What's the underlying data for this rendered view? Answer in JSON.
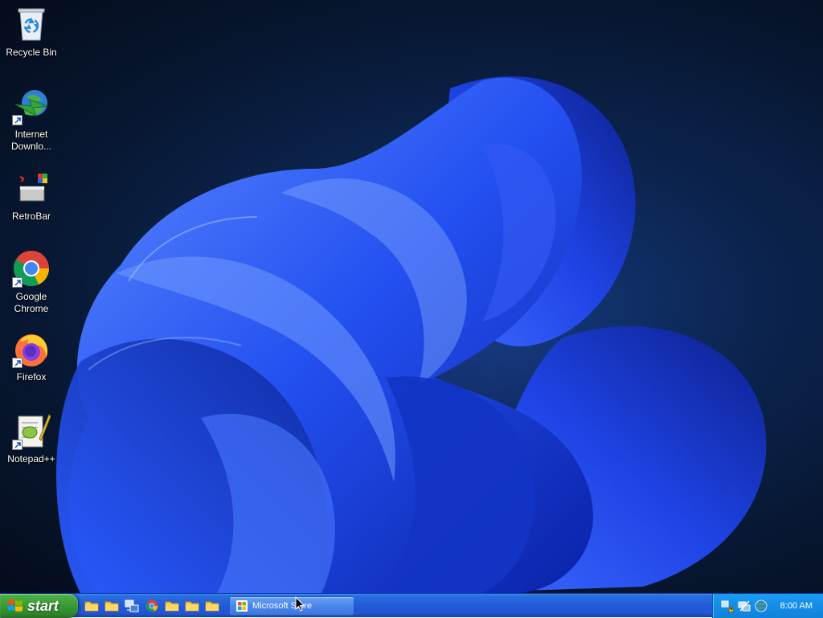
{
  "desktop": {
    "icons": [
      {
        "label": "Recycle Bin",
        "icon": "recycle-bin-icon"
      },
      {
        "label": "Internet Downlo...",
        "icon": "internet-download-manager-icon"
      },
      {
        "label": "RetroBar",
        "icon": "retrobar-icon"
      },
      {
        "label": "Google Chrome",
        "icon": "chrome-icon"
      },
      {
        "label": "Firefox",
        "icon": "firefox-icon"
      },
      {
        "label": "Notepad++",
        "icon": "notepadpp-icon"
      }
    ]
  },
  "taskbar": {
    "start_label": "start",
    "quick_launch": [
      "folder-icon",
      "folder-icon",
      "network-icon",
      "chrome-icon",
      "folder-icon",
      "folder-icon",
      "folder-icon"
    ],
    "active_task": {
      "label": "Microsoft Store",
      "icon": "store-icon"
    },
    "tray_icons": [
      "network-warning-icon",
      "network-disconnected-icon",
      "globe-icon"
    ],
    "clock": "8:00 AM"
  },
  "colors": {
    "taskbar_blue": "#245edb",
    "start_green": "#3b9b36",
    "tray_blue": "#168fe8",
    "wallpaper_bloom": "#1f4fff"
  }
}
